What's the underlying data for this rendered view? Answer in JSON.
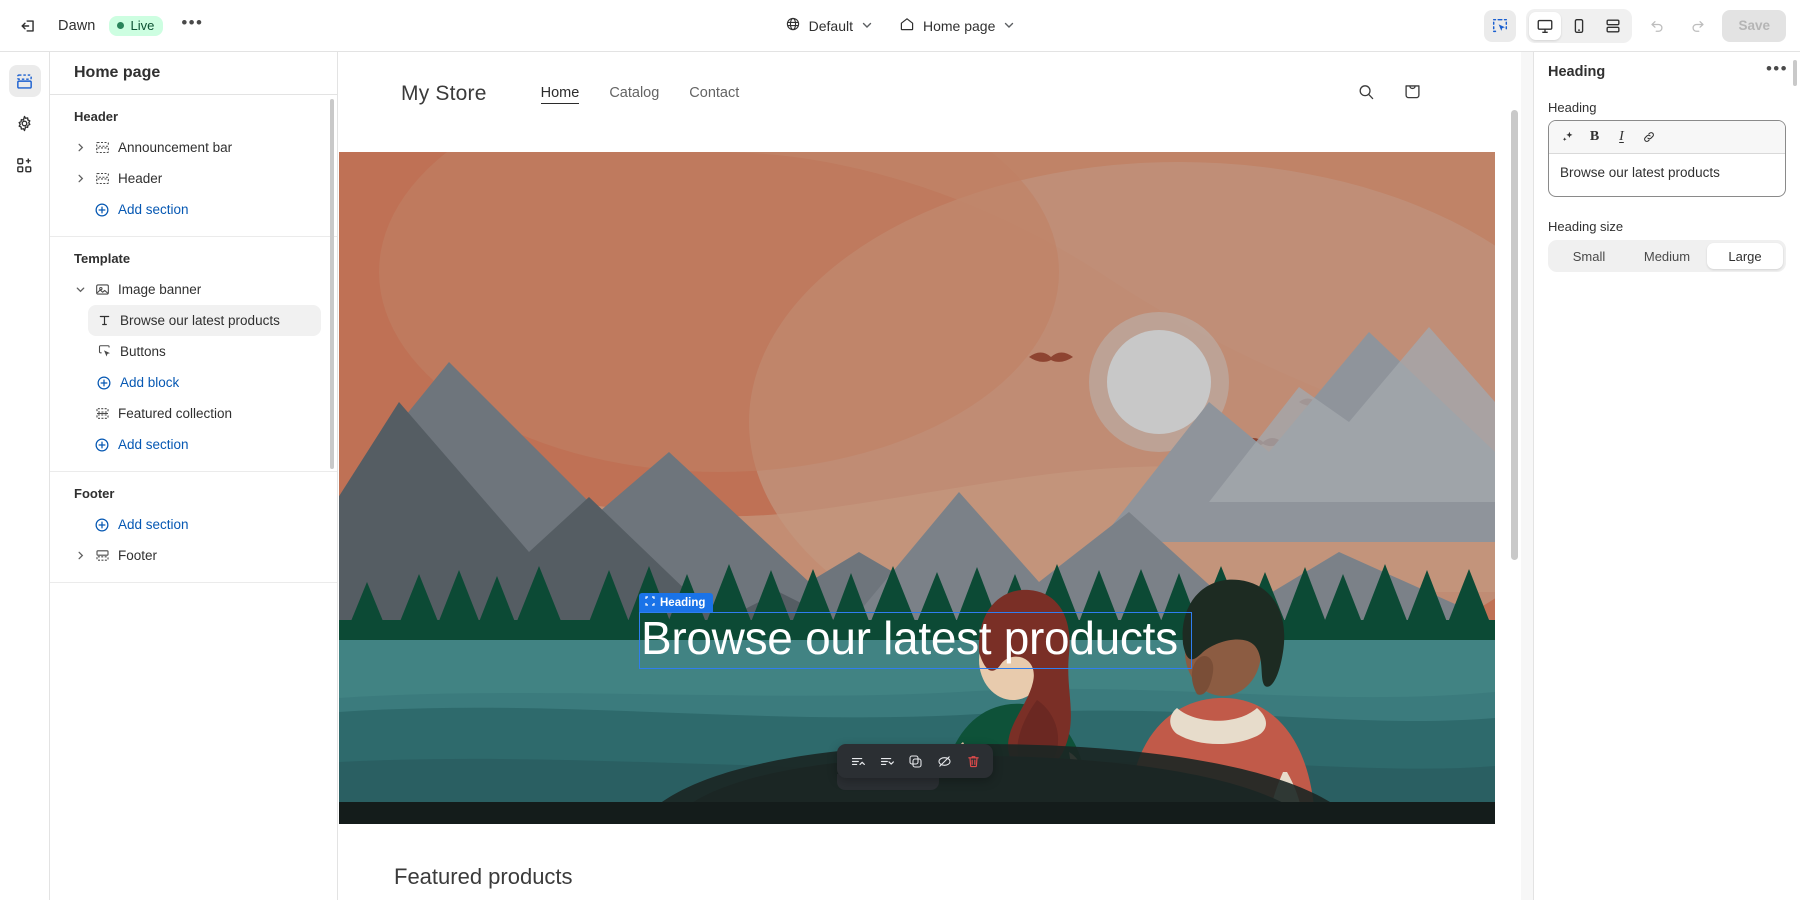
{
  "topbar": {
    "exit_icon": "exit-icon",
    "theme_name": "Dawn",
    "live_label": "Live",
    "more_label": "•••",
    "locale_selector": {
      "icon": "globe-icon",
      "value": "Default",
      "chevron": "chevron-down-icon"
    },
    "page_selector": {
      "icon": "home-icon",
      "value": "Home page",
      "chevron": "chevron-down-icon"
    },
    "select_mode_icon": "cursor-select-icon",
    "devices": [
      {
        "name": "desktop",
        "icon": "desktop-icon",
        "active": true
      },
      {
        "name": "mobile",
        "icon": "mobile-icon",
        "active": false
      },
      {
        "name": "fullscreen",
        "icon": "fullscreen-icon",
        "active": false
      }
    ],
    "undo_icon": "undo-icon",
    "redo_icon": "redo-icon",
    "save_label": "Save"
  },
  "rail": {
    "items": [
      {
        "name": "sections",
        "icon": "sections-icon",
        "active": true
      },
      {
        "name": "settings",
        "icon": "gear-icon",
        "active": false
      },
      {
        "name": "apps",
        "icon": "apps-icon",
        "active": false
      }
    ]
  },
  "sidebar": {
    "title": "Home page",
    "groups": [
      {
        "label": "Header",
        "rows": [
          {
            "label": "Announcement bar",
            "icon": "section-icon",
            "twisty": "chevron-right-icon",
            "kind": "section"
          },
          {
            "label": "Header",
            "icon": "section-icon",
            "twisty": "chevron-right-icon",
            "kind": "section"
          },
          {
            "label": "Add section",
            "icon": "plus-circle-icon",
            "kind": "add"
          }
        ]
      },
      {
        "label": "Template",
        "rows": [
          {
            "label": "Image banner",
            "icon": "image-icon",
            "twisty": "chevron-down-icon",
            "kind": "section"
          },
          {
            "label": "Browse our latest products",
            "icon": "text-icon",
            "kind": "block",
            "selected": true
          },
          {
            "label": "Buttons",
            "icon": "button-icon",
            "kind": "block"
          },
          {
            "label": "Add block",
            "icon": "plus-circle-icon",
            "kind": "add-block"
          },
          {
            "label": "Featured collection",
            "icon": "collection-icon",
            "kind": "section"
          },
          {
            "label": "Add section",
            "icon": "plus-circle-icon",
            "kind": "add"
          }
        ]
      },
      {
        "label": "Footer",
        "rows": [
          {
            "label": "Add section",
            "icon": "plus-circle-icon",
            "kind": "add"
          },
          {
            "label": "Footer",
            "icon": "footer-icon",
            "twisty": "chevron-right-icon",
            "kind": "section"
          }
        ]
      }
    ]
  },
  "canvas": {
    "store": {
      "logo": "My Store",
      "nav": [
        {
          "label": "Home",
          "active": true
        },
        {
          "label": "Catalog",
          "active": false
        },
        {
          "label": "Contact",
          "active": false
        }
      ],
      "search_icon": "search-icon",
      "cart_icon": "shopping-bag-icon"
    },
    "banner": {
      "heading": "Browse our latest products",
      "selection_badge": "Heading",
      "selection_badge_icon": "block-handle-icon",
      "colors": {
        "sky_top": "#bf7155",
        "sky_mid": "#c08a6d",
        "sky_warm": "#c3957a",
        "sun": "#c8c8c8",
        "mountain_dark": "#555d63",
        "mountain_mid": "#6e757c",
        "mountain_light": "#8f949b",
        "pine": "#0c4a35",
        "water_top": "#3b7b7d",
        "water_mid": "#2e6a6c",
        "water_deep": "#2a5f62",
        "boat": "#23302e",
        "shirt_red": "#c15a49",
        "shirt_green": "#0e5239",
        "hair_red": "#7a2f26",
        "hair_dark": "#1d2b22",
        "skin_dark": "#8c5c42",
        "skin_light": "#e2c2a3"
      }
    },
    "floating_toolbar": [
      {
        "name": "move-up-icon"
      },
      {
        "name": "move-down-icon"
      },
      {
        "name": "duplicate-icon"
      },
      {
        "name": "hide-icon"
      },
      {
        "name": "delete-icon",
        "color": "#e04b4b"
      }
    ],
    "featured_title": "Featured products"
  },
  "right_panel": {
    "title": "Heading",
    "more_label": "•••",
    "heading_field_label": "Heading",
    "rte_buttons": [
      {
        "name": "ai-sparkle-icon",
        "glyph": "✧"
      },
      {
        "name": "bold-icon",
        "glyph": "B"
      },
      {
        "name": "italic-icon",
        "glyph": "I"
      },
      {
        "name": "link-icon",
        "glyph": "ὑ7"
      }
    ],
    "heading_value": "Browse our latest products",
    "heading_size_label": "Heading size",
    "heading_sizes": [
      {
        "label": "Small",
        "active": false
      },
      {
        "label": "Medium",
        "active": false
      },
      {
        "label": "Large",
        "active": true
      }
    ]
  },
  "colors": {
    "accent_blue": "#0658b3",
    "selection_blue": "#2f7ef0",
    "badge_green_bg": "#cdfee1",
    "badge_green_fg": "#0c5132"
  }
}
